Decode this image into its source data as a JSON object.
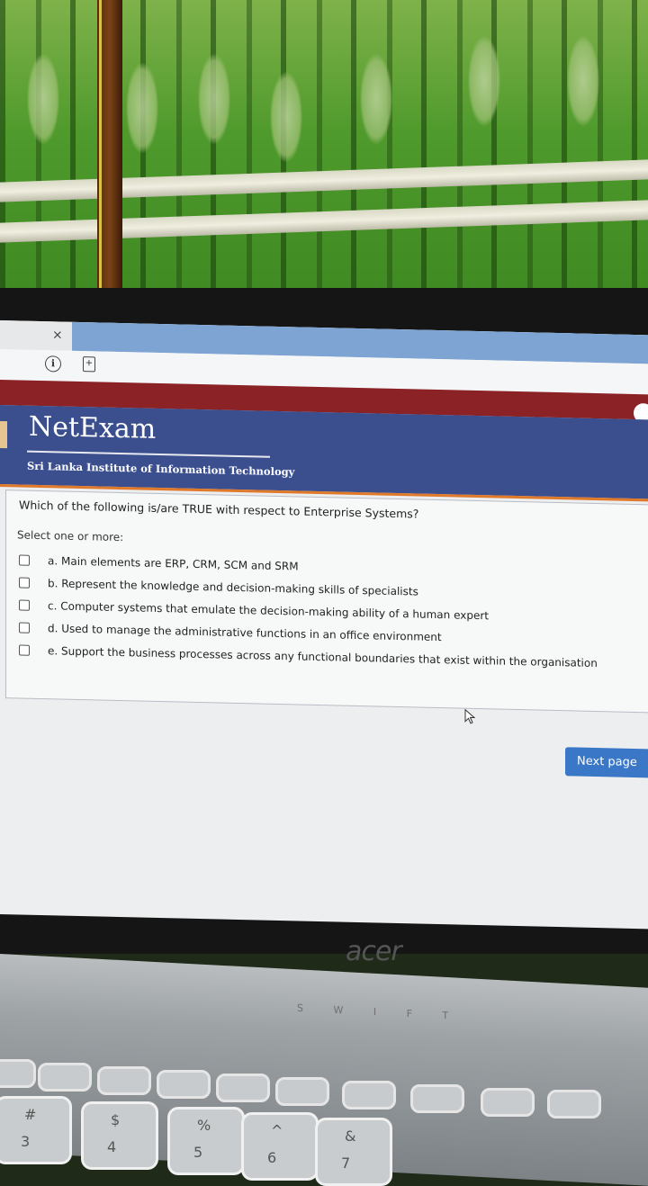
{
  "browser": {
    "tab_close": "×",
    "info_icon": "i",
    "page_icon": "+"
  },
  "header": {
    "brand": "NetExam",
    "institute": "Sri Lanka Institute of Information Technology"
  },
  "question": {
    "text": "Which of the following is/are TRUE with respect to Enterprise Systems?",
    "select_label": "Select one or more:",
    "options": [
      {
        "label": "a. Main elements are ERP, CRM, SCM and SRM",
        "checked": false
      },
      {
        "label": "b. Represent the knowledge and decision-making skills of specialists",
        "checked": false
      },
      {
        "label": "c. Computer systems that emulate the decision-making ability of a human expert",
        "checked": false
      },
      {
        "label": "d. Used to manage the administrative functions in an office environment",
        "checked": false
      },
      {
        "label": "e. Support the business processes across any functional boundaries that exist within the organisation",
        "checked": false
      }
    ]
  },
  "navigation": {
    "next_label": "Next page"
  },
  "laptop": {
    "brand": "acer",
    "keyboard_hint": "S W I F T",
    "num_keys": [
      {
        "top": "#",
        "bottom": "3"
      },
      {
        "top": "$",
        "bottom": "4"
      },
      {
        "top": "%",
        "bottom": "5"
      },
      {
        "top": "^",
        "bottom": "6"
      },
      {
        "top": "&",
        "bottom": "7"
      }
    ]
  },
  "colors": {
    "header_bg": "#3b4f8f",
    "red_band": "#8a2226",
    "accent_orange": "#e07a2a",
    "button_blue": "#3a78c7"
  }
}
